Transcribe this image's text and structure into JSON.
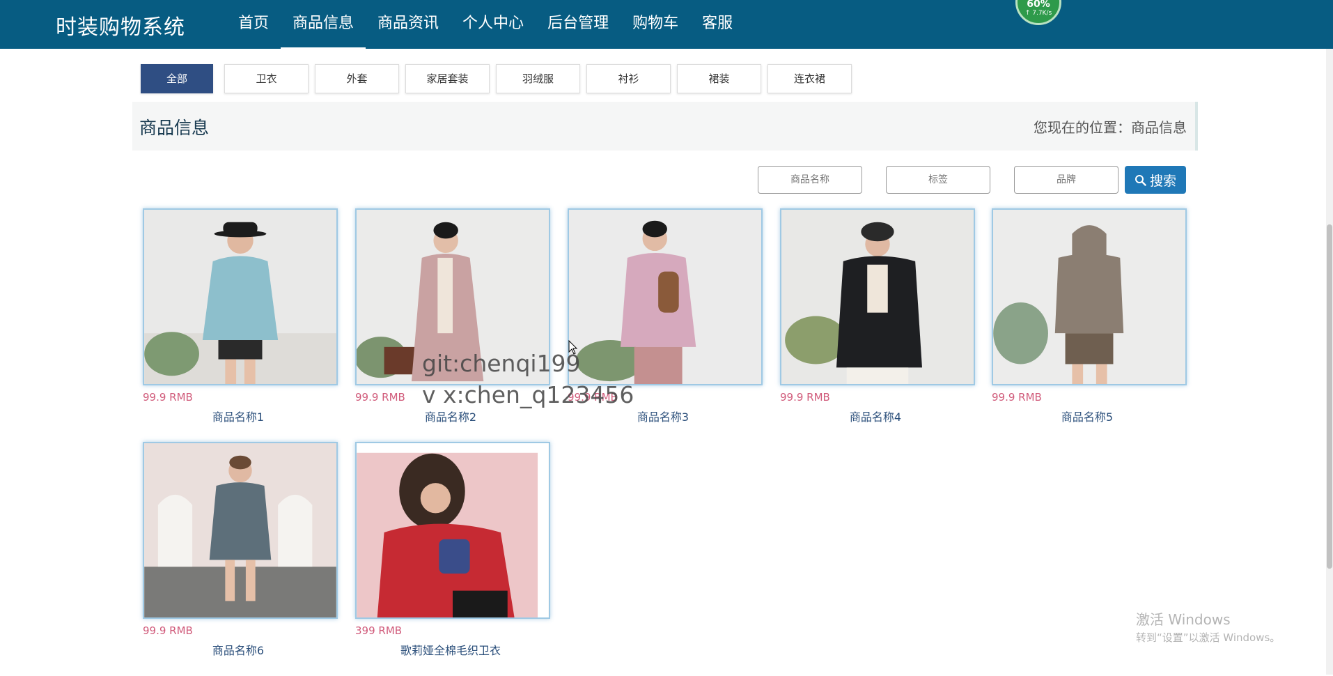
{
  "header": {
    "logo": "时装购物系统",
    "nav": [
      "首页",
      "商品信息",
      "商品资讯",
      "个人中心",
      "后台管理",
      "购物车",
      "客服"
    ],
    "active_nav": "商品信息",
    "net_widget": {
      "percent": "60%",
      "speed": "↑ 7.7K/s"
    }
  },
  "categories": [
    "全部",
    "卫衣",
    "外套",
    "家居套装",
    "羽绒服",
    "衬衫",
    "裙装",
    "连衣裙"
  ],
  "active_category": "全部",
  "info_bar": {
    "title": "商品信息",
    "location": "您现在的位置：商品信息"
  },
  "search": {
    "name_placeholder": "商品名称",
    "tag_placeholder": "标签",
    "brand_placeholder": "品牌",
    "button_label": "搜索"
  },
  "products": [
    {
      "price": "99.9 RMB",
      "name": "商品名称1",
      "garment": "#8dbfcc"
    },
    {
      "price": "99.9 RMB",
      "name": "商品名称2",
      "garment": "#c9a2a2"
    },
    {
      "price": "99.9 RMB",
      "name": "商品名称3",
      "garment": "#d6a9bd"
    },
    {
      "price": "99.9 RMB",
      "name": "商品名称4",
      "garment": "#1e1f22"
    },
    {
      "price": "99.9 RMB",
      "name": "商品名称5",
      "garment": "#8b7e72"
    },
    {
      "price": "99.9 RMB",
      "name": "商品名称6",
      "garment": "#5d6f7a"
    },
    {
      "price": "399 RMB",
      "name": "歌莉娅全棉毛织卫衣",
      "garment": "#c62a33"
    }
  ],
  "watermark": {
    "line1": "git:chenqi199",
    "line2": "v x:chen_q123456"
  },
  "windows_activation": {
    "line1": "激活 Windows",
    "line2": "转到“设置”以激活 Windows。"
  }
}
